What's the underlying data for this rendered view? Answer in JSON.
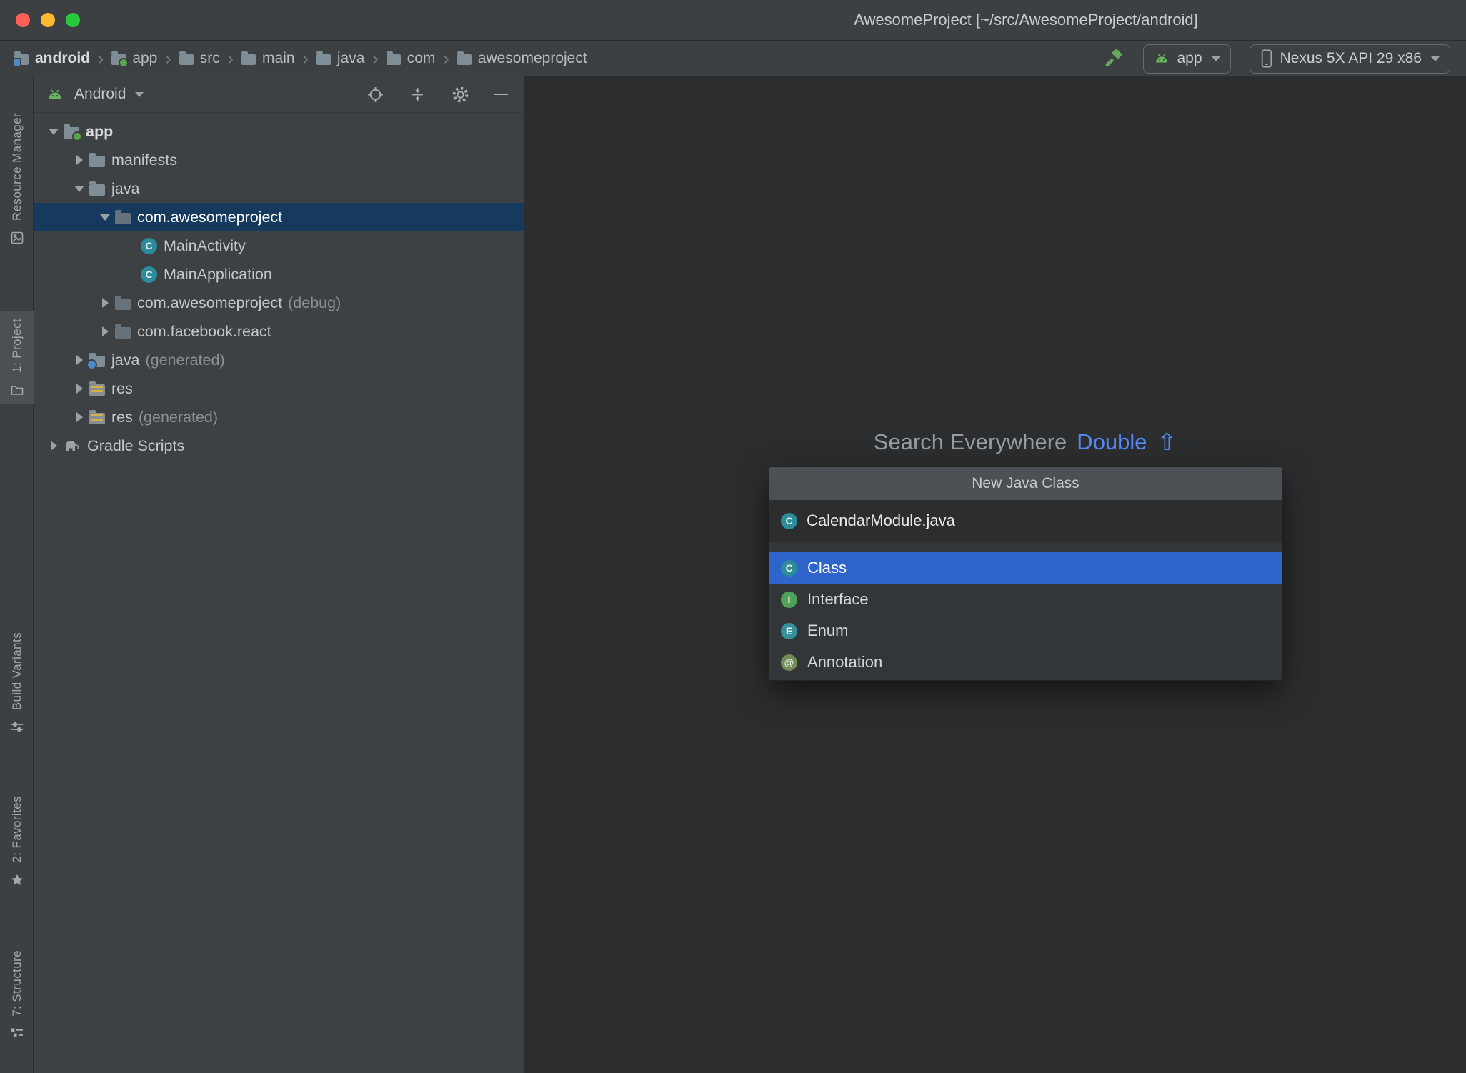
{
  "window": {
    "title": "AwesomeProject [~/src/AwesomeProject/android]"
  },
  "navbar": {
    "separator": "›",
    "breadcrumbs": [
      "android",
      "app",
      "src",
      "main",
      "java",
      "com",
      "awesomeproject"
    ],
    "run_config_label": "app",
    "device_label": "Nexus 5X API 29 x86"
  },
  "tool_strip": {
    "buttons": [
      {
        "mnemonic": "",
        "label": "Resource Manager"
      },
      {
        "mnemonic": "1",
        "label": ": Project"
      },
      {
        "mnemonic": "",
        "label": "Build Variants"
      },
      {
        "mnemonic": "2",
        "label": ": Favorites"
      },
      {
        "mnemonic": "7",
        "label": ": Structure"
      }
    ]
  },
  "project_panel": {
    "view_selector": "Android",
    "tree": [
      {
        "label": "app",
        "extra": ""
      },
      {
        "label": "manifests",
        "extra": ""
      },
      {
        "label": "java",
        "extra": ""
      },
      {
        "label": "com.awesomeproject",
        "extra": ""
      },
      {
        "label": "MainActivity",
        "extra": ""
      },
      {
        "label": "MainApplication",
        "extra": ""
      },
      {
        "label": "com.awesomeproject",
        "extra": "(debug)"
      },
      {
        "label": "com.facebook.react",
        "extra": ""
      },
      {
        "label": "java",
        "extra": "(generated)"
      },
      {
        "label": "res",
        "extra": ""
      },
      {
        "label": "res",
        "extra": "(generated)"
      },
      {
        "label": "Gradle Scripts",
        "extra": ""
      }
    ]
  },
  "editor": {
    "hint_label": "Search Everywhere",
    "hint_shortcut": "Double",
    "hint_key": "⇧"
  },
  "popup": {
    "title": "New Java Class",
    "input_value": "CalendarModule.java",
    "options": [
      {
        "label": "Class"
      },
      {
        "label": "Interface"
      },
      {
        "label": "Enum"
      },
      {
        "label": "Annotation"
      }
    ]
  },
  "type_glyphs": {
    "class": "C",
    "interface": "I",
    "enum": "E",
    "annotation": "@"
  },
  "colors": {
    "accent_blue": "#548af7",
    "selection_blue": "#2f65ca",
    "tree_selection_blue": "#163a5e",
    "android_green": "#68b55e"
  }
}
